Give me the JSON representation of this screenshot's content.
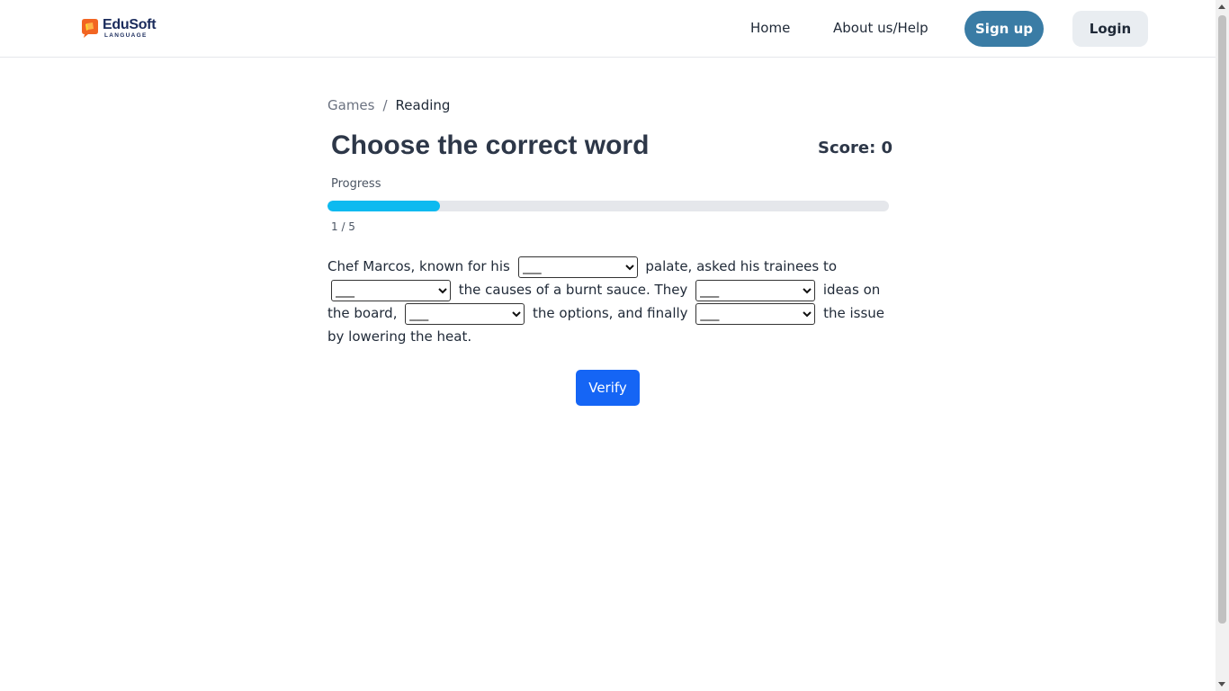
{
  "header": {
    "logo_name": "EduSoft",
    "logo_sub": "LANGUAGE",
    "nav": {
      "home": "Home",
      "about": "About us/Help"
    },
    "signup_label": "Sign up",
    "login_label": "Login"
  },
  "breadcrumb": {
    "games": "Games",
    "separator": "/",
    "current": "Reading"
  },
  "game": {
    "title": "Choose the correct word",
    "score_text": "Score: 0",
    "progress_label": "Progress",
    "progress_fraction": 0.2,
    "progress_count": "1 / 5"
  },
  "passage": {
    "seg1": "Chef Marcos, known for his",
    "seg2": "palate, asked his trainees to",
    "seg3": "the causes of a burnt sauce. They",
    "seg4": "ideas on the board,",
    "seg5": "the options, and finally",
    "seg6": "the issue by lowering the heat.",
    "blank_placeholder": "___"
  },
  "verify_label": "Verify",
  "colors": {
    "accent": "#1565f5",
    "signup": "#3a7ca5",
    "progress": "#0dbaf0"
  }
}
